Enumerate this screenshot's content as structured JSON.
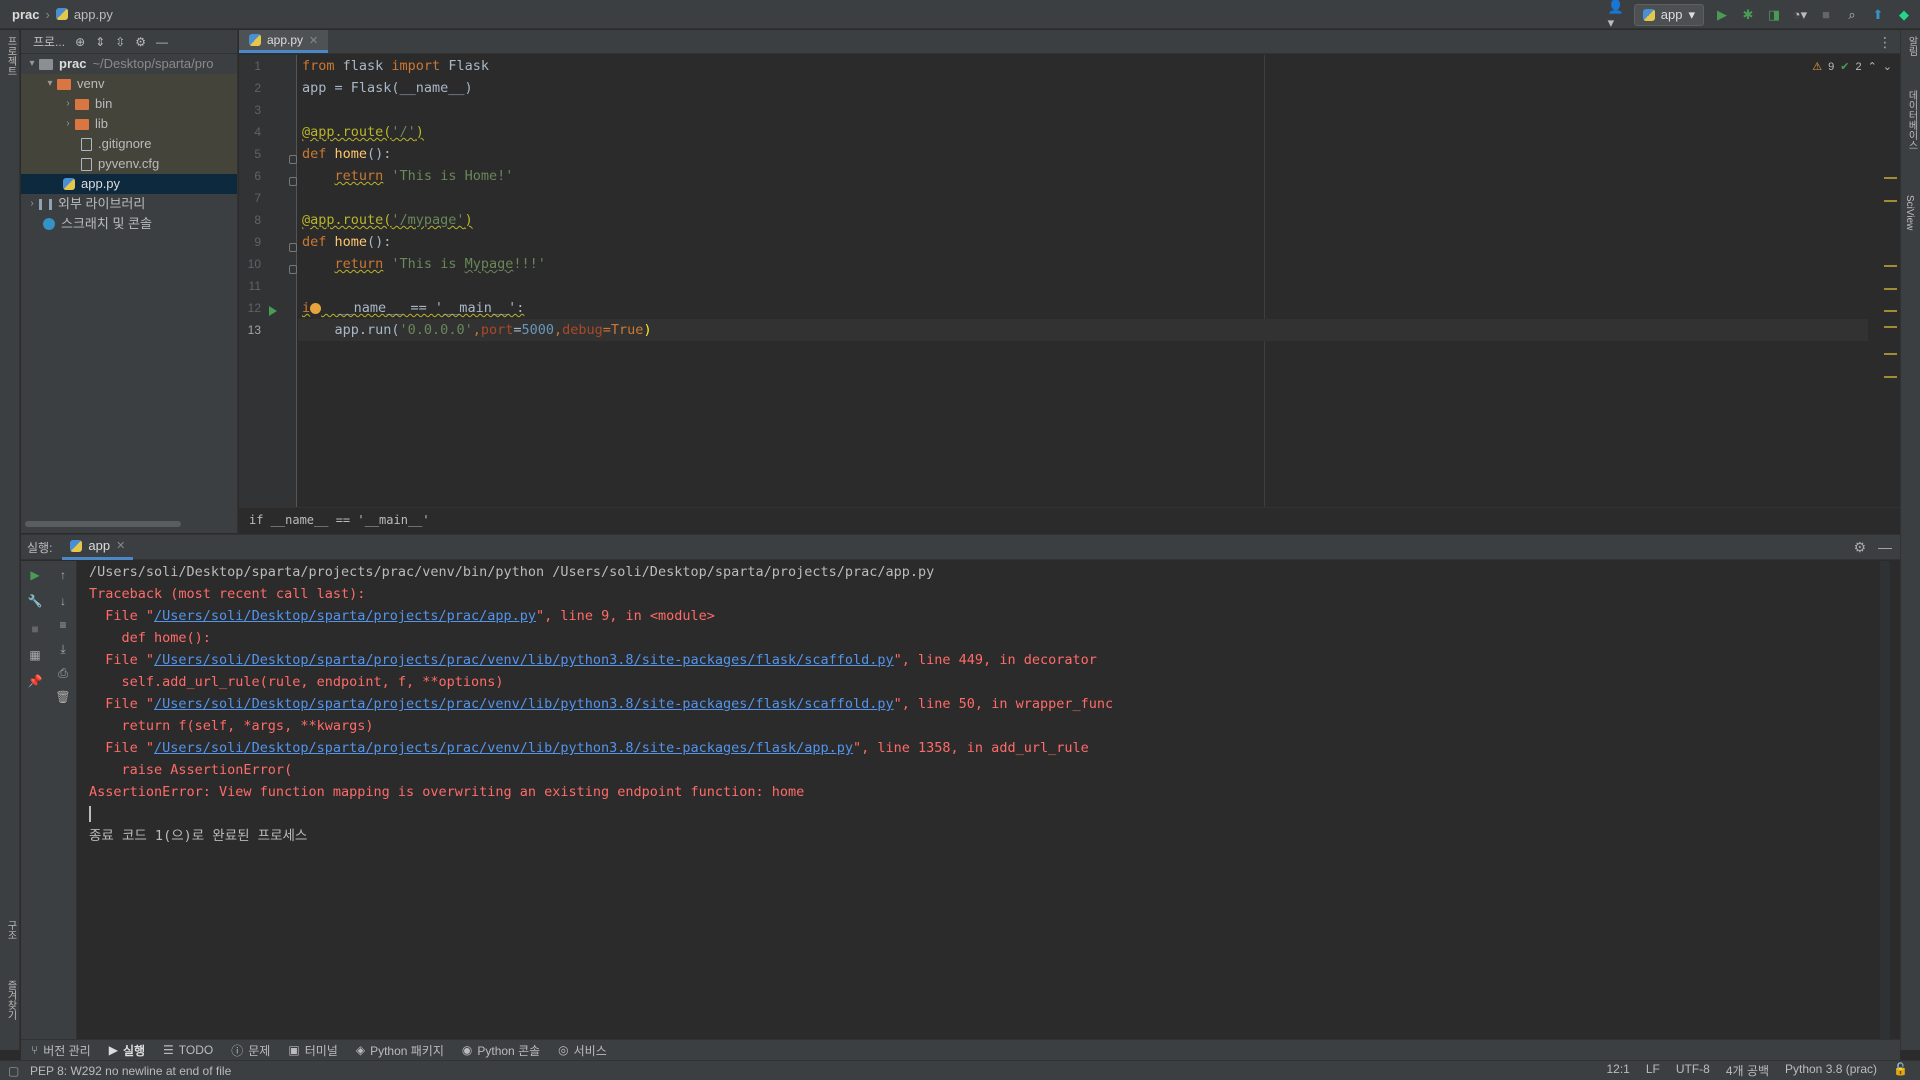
{
  "nav": {
    "project": "prac",
    "file": "app.py"
  },
  "toolbar": {
    "run_config": "app"
  },
  "left_strip": {
    "project_label": "프로젝트",
    "structure_label": "구조",
    "bookmarks_label": "즐겨찾기"
  },
  "right_strip": {
    "notifications_label": "알림",
    "database_label": "데이터베이스",
    "sciview_label": "SciView"
  },
  "project_panel": {
    "title": "프로...",
    "tree": {
      "root_name": "prac",
      "root_path": "~/Desktop/sparta/pro",
      "venv": "venv",
      "bin": "bin",
      "lib": "lib",
      "gitignore": ".gitignore",
      "pyvenv": "pyvenv.cfg",
      "app": "app.py",
      "external_libs": "외부 라이브러리",
      "scratches": "스크래치 및 콘솔"
    }
  },
  "editor": {
    "tab": "app.py",
    "inspection": {
      "warnings": "9",
      "ok": "2"
    },
    "line_numbers": [
      "1",
      "2",
      "3",
      "4",
      "5",
      "6",
      "7",
      "8",
      "9",
      "10",
      "11",
      "12",
      "13"
    ],
    "code": {
      "l1_from": "from",
      "l1_mod": " flask ",
      "l1_import": "import",
      "l1_name": " Flask",
      "l2": "app = Flask(__name__)",
      "l4_dec": "@app.route(",
      "l4_str": "'/'",
      "l4_end": ")",
      "l5_def": "def",
      "l5_fn": " home",
      "l5_end": "():",
      "l6_ret": "return",
      "l6_str": " 'This is Home!'",
      "l8_dec": "@app.route(",
      "l8_str": "'/mypage'",
      "l8_end": ")",
      "l9_def": "def",
      "l9_fn": " home",
      "l9_end": "():",
      "l10_ret": "return",
      "l10_str_a": " 'This is ",
      "l10_str_b": "Mypage",
      "l10_str_c": "!!!'",
      "l12_if": "i",
      "l12_rest": "  __name__ == '__main__':",
      "l13_a": "app",
      "l13_b": ".run(",
      "l13_c": "'0.0.0.0'",
      "l13_d": ",",
      "l13_e": "port",
      "l13_f": "=",
      "l13_g": "5000",
      "l13_h": ",",
      "l13_i": "debug",
      "l13_j": "=True",
      "l13_k": ")"
    },
    "breadcrumb": "if __name__ == '__main__'"
  },
  "run_panel": {
    "label": "실행:",
    "tab": "app",
    "output": {
      "cmd": "/Users/soli/Desktop/sparta/projects/prac/venv/bin/python /Users/soli/Desktop/sparta/projects/prac/app.py",
      "traceback": "Traceback (most recent call last):",
      "f1_pre": "  File \"",
      "f1_link": "/Users/soli/Desktop/sparta/projects/prac/app.py",
      "f1_post": "\", line 9, in <module>",
      "f1_code": "    def home():",
      "f2_pre": "  File \"",
      "f2_link": "/Users/soli/Desktop/sparta/projects/prac/venv/lib/python3.8/site-packages/flask/scaffold.py",
      "f2_post": "\", line 449, in decorator",
      "f2_code": "    self.add_url_rule(rule, endpoint, f, **options)",
      "f3_pre": "  File \"",
      "f3_link": "/Users/soli/Desktop/sparta/projects/prac/venv/lib/python3.8/site-packages/flask/scaffold.py",
      "f3_post": "\", line 50, in wrapper_func",
      "f3_code": "    return f(self, *args, **kwargs)",
      "f4_pre": "  File \"",
      "f4_link": "/Users/soli/Desktop/sparta/projects/prac/venv/lib/python3.8/site-packages/flask/app.py",
      "f4_post": "\", line 1358, in add_url_rule",
      "f4_code": "    raise AssertionError(",
      "error": "AssertionError: View function mapping is overwriting an existing endpoint function: home",
      "exit": "종료 코드 1(으)로 완료된 프로세스"
    }
  },
  "bottom_tabs": [
    "버전 관리",
    "실행",
    "TODO",
    "문제",
    "터미널",
    "Python 패키지",
    "Python 콘솔",
    "서비스"
  ],
  "status": {
    "message": "PEP 8: W292 no newline at end of file",
    "position": "12:1",
    "line_sep": "LF",
    "encoding": "UTF-8",
    "indent": "4개 공백",
    "interpreter": "Python 3.8 (prac)"
  },
  "colors": {
    "accent": "#4a88c7",
    "error": "#ff6b68",
    "link": "#5394ec",
    "keyword": "#cc7832",
    "string": "#6a8759"
  }
}
